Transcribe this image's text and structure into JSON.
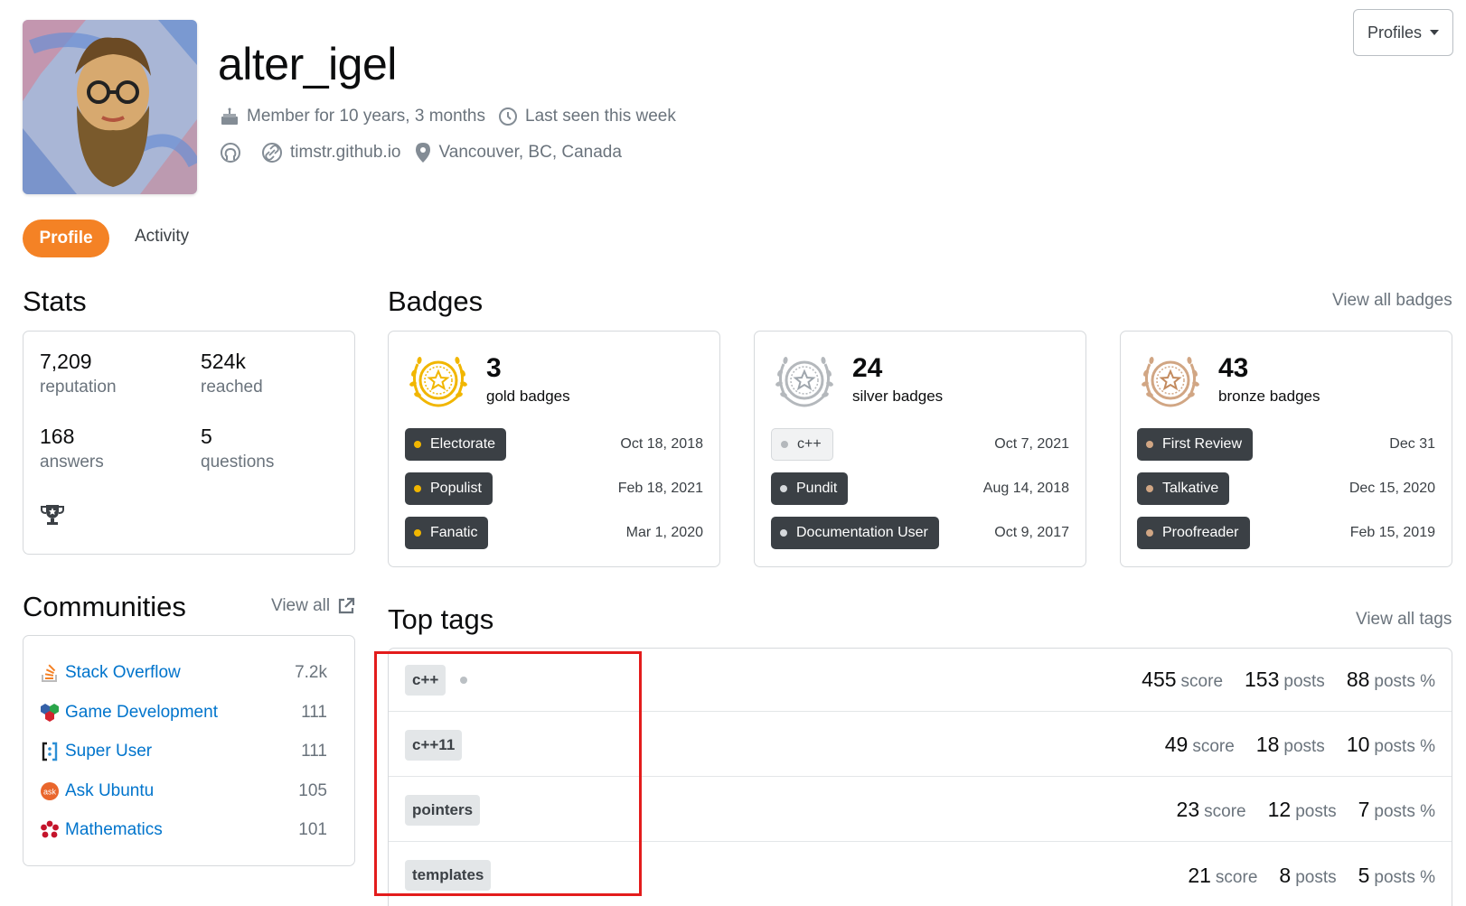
{
  "user": {
    "name": "alter_igel",
    "member_for": "Member for 10 years, 3 months",
    "last_seen": "Last seen this week",
    "website": "timstr.github.io",
    "location": "Vancouver, BC, Canada"
  },
  "header": {
    "profiles_label": "Profiles"
  },
  "tabs": {
    "profile": "Profile",
    "activity": "Activity"
  },
  "stats": {
    "title": "Stats",
    "reputation": {
      "value": "7,209",
      "label": "reputation"
    },
    "reached": {
      "value": "524k",
      "label": "reached"
    },
    "answers": {
      "value": "168",
      "label": "answers"
    },
    "questions": {
      "value": "5",
      "label": "questions"
    }
  },
  "communities": {
    "title": "Communities",
    "view_all": "View all",
    "items": [
      {
        "name": "Stack Overflow",
        "rep": "7.2k"
      },
      {
        "name": "Game Development",
        "rep": "111"
      },
      {
        "name": "Super User",
        "rep": "111"
      },
      {
        "name": "Ask Ubuntu",
        "rep": "105"
      },
      {
        "name": "Mathematics",
        "rep": "101"
      }
    ]
  },
  "badges": {
    "title": "Badges",
    "view_all": "View all badges",
    "gold": {
      "count": "3",
      "label": "gold badges",
      "color": "#f1b600",
      "items": [
        {
          "name": "Electorate",
          "date": "Oct 18, 2018"
        },
        {
          "name": "Populist",
          "date": "Feb 18, 2021"
        },
        {
          "name": "Fanatic",
          "date": "Mar 1, 2020"
        }
      ]
    },
    "silver": {
      "count": "24",
      "label": "silver badges",
      "color": "#b4b8bc",
      "items": [
        {
          "name": "c++",
          "date": "Oct 7, 2021"
        },
        {
          "name": "Pundit",
          "date": "Aug 14, 2018"
        },
        {
          "name": "Documentation User",
          "date": "Oct 9, 2017"
        }
      ]
    },
    "bronze": {
      "count": "43",
      "label": "bronze badges",
      "color": "#d1a684",
      "items": [
        {
          "name": "First Review",
          "date": "Dec 31"
        },
        {
          "name": "Talkative",
          "date": "Dec 15, 2020"
        },
        {
          "name": "Proofreader",
          "date": "Feb 15, 2019"
        }
      ]
    }
  },
  "top_tags": {
    "title": "Top tags",
    "view_all": "View all tags",
    "units": {
      "score": "score",
      "posts": "posts",
      "posts_pct": "posts %"
    },
    "items": [
      {
        "tag": "c++",
        "score": "455",
        "posts": "153",
        "posts_pct": "88"
      },
      {
        "tag": "c++11",
        "score": "49",
        "posts": "18",
        "posts_pct": "10"
      },
      {
        "tag": "pointers",
        "score": "23",
        "posts": "12",
        "posts_pct": "7"
      },
      {
        "tag": "templates",
        "score": "21",
        "posts": "8",
        "posts_pct": "5"
      }
    ]
  },
  "colors": {
    "accent": "#f48225",
    "link": "#0074cc",
    "highlight": "#e31c1c"
  }
}
